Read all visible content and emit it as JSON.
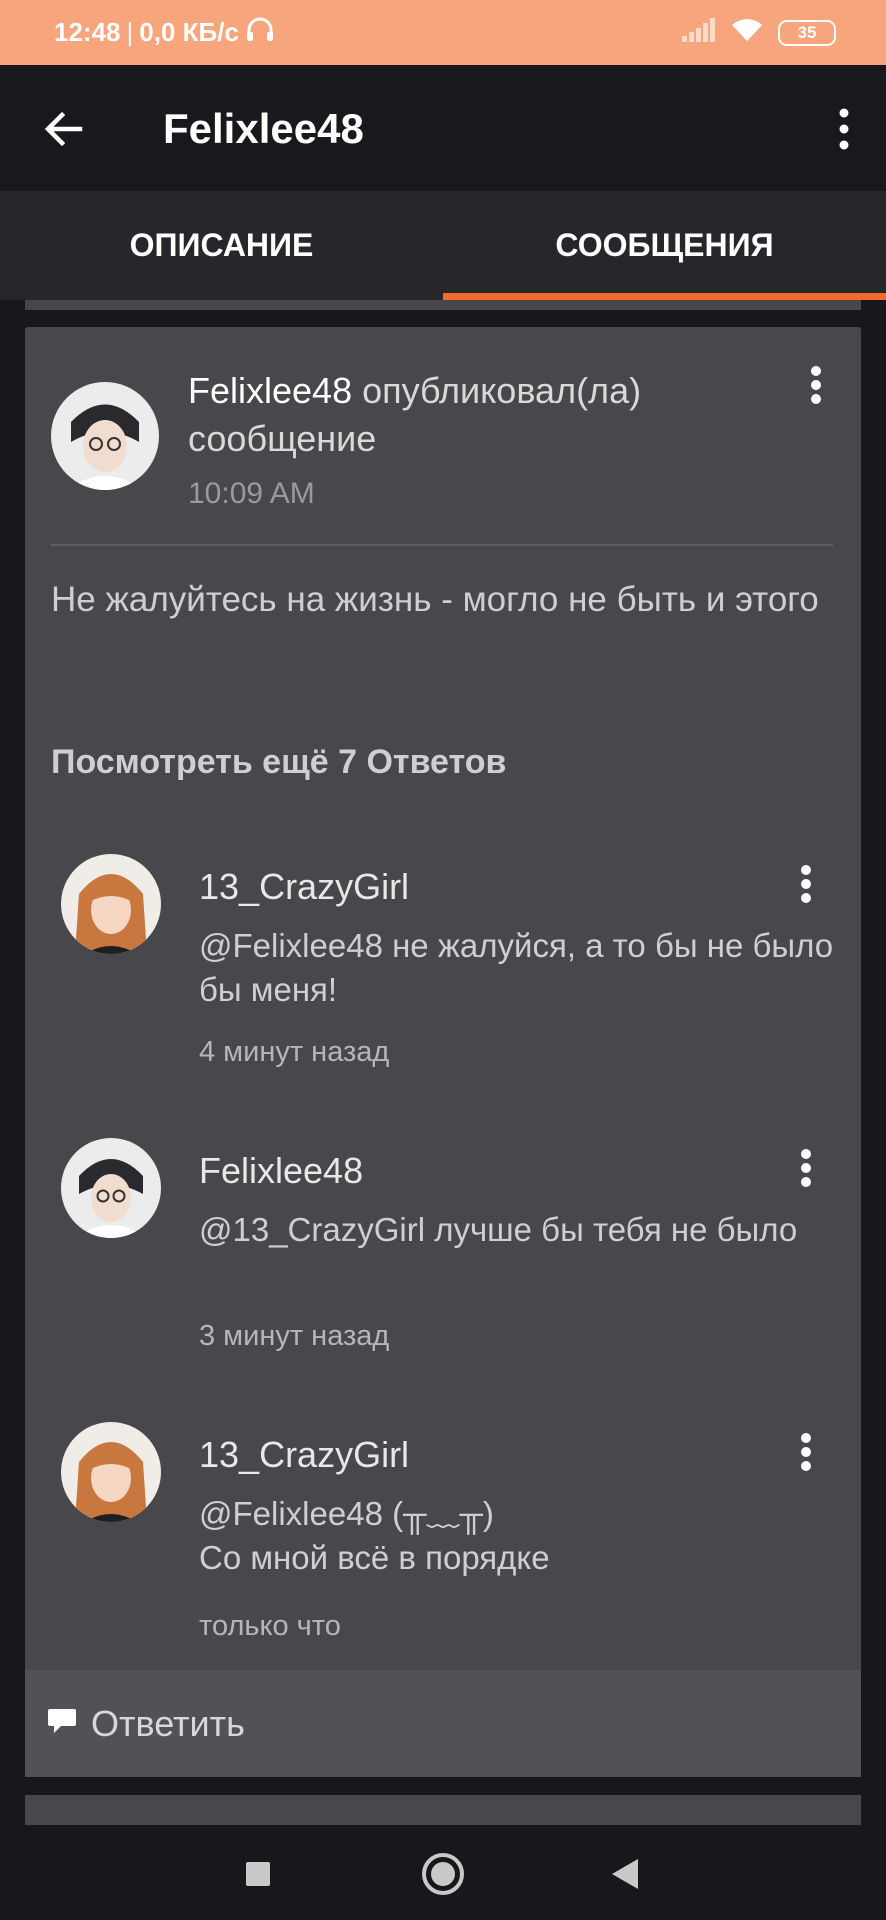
{
  "status_bar": {
    "time": "12:48",
    "separator": "|",
    "network_speed": "0,0 КБ/с",
    "battery": "35",
    "icons": [
      "headphones-icon",
      "signal-icon",
      "wifi-icon",
      "battery-icon"
    ]
  },
  "toolbar": {
    "title": "Felixlee48",
    "back_icon": "arrow-left-icon",
    "menu_icon": "more-vertical-icon"
  },
  "tabs": [
    {
      "label": "ОПИСАНИЕ",
      "active": false
    },
    {
      "label": "СООБЩЕНИЯ",
      "active": true
    }
  ],
  "post": {
    "author": "Felixlee48",
    "action": "опубликовал(ла) сообщение",
    "time": "10:09 AM",
    "body": "Не жалуйтесь на жизнь - могло не быть и этого",
    "more_replies": "Посмотреть ещё 7 Ответов"
  },
  "replies": [
    {
      "author": "13_CrazyGirl",
      "text": "@Felixlee48  не жалуйся, а то бы не было бы меня!",
      "time": "4 минут назад"
    },
    {
      "author": "Felixlee48",
      "text": "@13_CrazyGirl  лучше бы тебя не было",
      "time": "3 минут назад"
    },
    {
      "author": "13_CrazyGirl",
      "text_line1": "@Felixlee48  (╥﹏╥)",
      "text_line2": "Со мной всё в порядке",
      "time": "только что"
    }
  ],
  "reply_action": {
    "label": "Ответить",
    "icon": "comment-icon"
  },
  "navbar": {
    "icons": [
      "recents-square-icon",
      "home-circle-icon",
      "back-triangle-icon"
    ]
  },
  "colors": {
    "accent": "#f26a2c",
    "status_bar": "#f7a57c",
    "card": "#48474c",
    "background": "#18171b"
  }
}
